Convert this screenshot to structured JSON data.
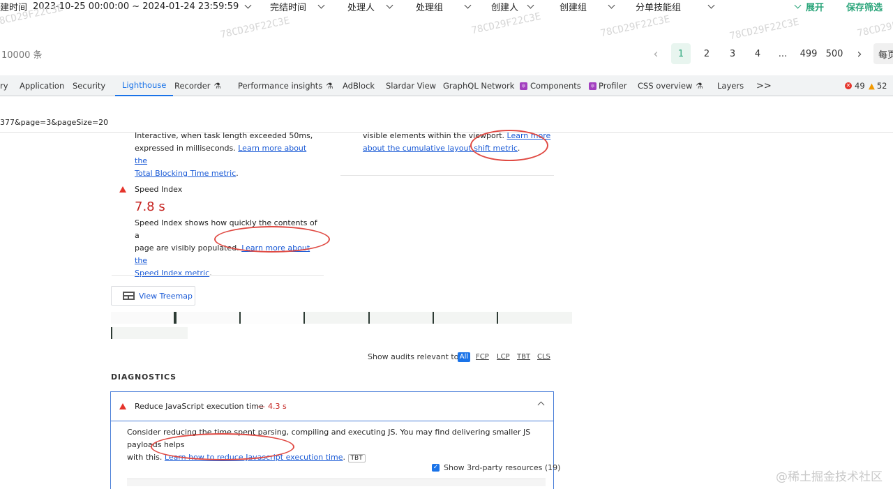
{
  "filters": {
    "create_time_label": "建时间",
    "create_time_value": "2023-10-25 00:00:00 ~ 2024-01-24 23:59:59",
    "finish_time": "完结时间",
    "handler": "处理人",
    "handler_group": "处理组",
    "creator": "创建人",
    "creator_group": "创建组",
    "skill_group": "分单技能组",
    "expand": "展开",
    "save_filter": "保存筛选",
    "watermark": "78CD29F22C3E"
  },
  "pager": {
    "total": "10000 条",
    "pages": [
      "1",
      "2",
      "3",
      "4",
      "...",
      "499",
      "500"
    ],
    "current": "1",
    "per_page": "每页"
  },
  "devtools": {
    "tabs": [
      "ry",
      "Application",
      "Security",
      "Lighthouse",
      "Recorder",
      "Performance insights",
      "AdBlock",
      "Slardar View",
      "GraphQL Network",
      "Components",
      "Profiler",
      "CSS overview",
      "Layers",
      ">>"
    ],
    "active_tab": "Lighthouse",
    "errors": "49",
    "warnings": "52",
    "url": "377&page=3&pageSize=20"
  },
  "report": {
    "tbt_text_1": "Interactive, when task length exceeded 50ms,",
    "tbt_text_2": "expressed in milliseconds.",
    "tbt_link_1": "Learn more about the",
    "tbt_link_2": "Total Blocking Time metric",
    "cls_text": "visible elements within the viewport.",
    "cls_link_1": "Learn more",
    "cls_link_2": "about the cumulative layout shift metric",
    "si_title": "Speed Index",
    "si_value": "7.8 s",
    "si_text_1": "Speed Index shows how quickly the contents of a",
    "si_text_2": "page are visibly populated.",
    "si_link_1": "Learn more about the",
    "si_link_2": "Speed Index metric",
    "treemap_button": "View Treemap",
    "audits_label": "Show audits relevant to:",
    "audit_filters": [
      "All",
      "FCP",
      "LCP",
      "TBT",
      "CLS"
    ],
    "diagnostics_heading": "DIAGNOSTICS",
    "diag_title": "Reduce JavaScript execution time",
    "diag_sep": "—",
    "diag_value": "4.3 s",
    "diag_text_1": "Consider reducing the time spent parsing, compiling and executing JS. You may find delivering smaller JS payloads helps",
    "diag_text_2": "with this.",
    "diag_link": "Learn how to reduce Javascript execution time",
    "diag_badge": "TBT",
    "third_party": "Show 3rd-party resources (19)"
  },
  "watermark_site": "@稀土掘金技术社区",
  "colors": {
    "accent_green": "#2aa57a",
    "link_blue": "#1a5ad6",
    "fail_red": "#c5221f",
    "annotation_red": "#e04a43"
  }
}
